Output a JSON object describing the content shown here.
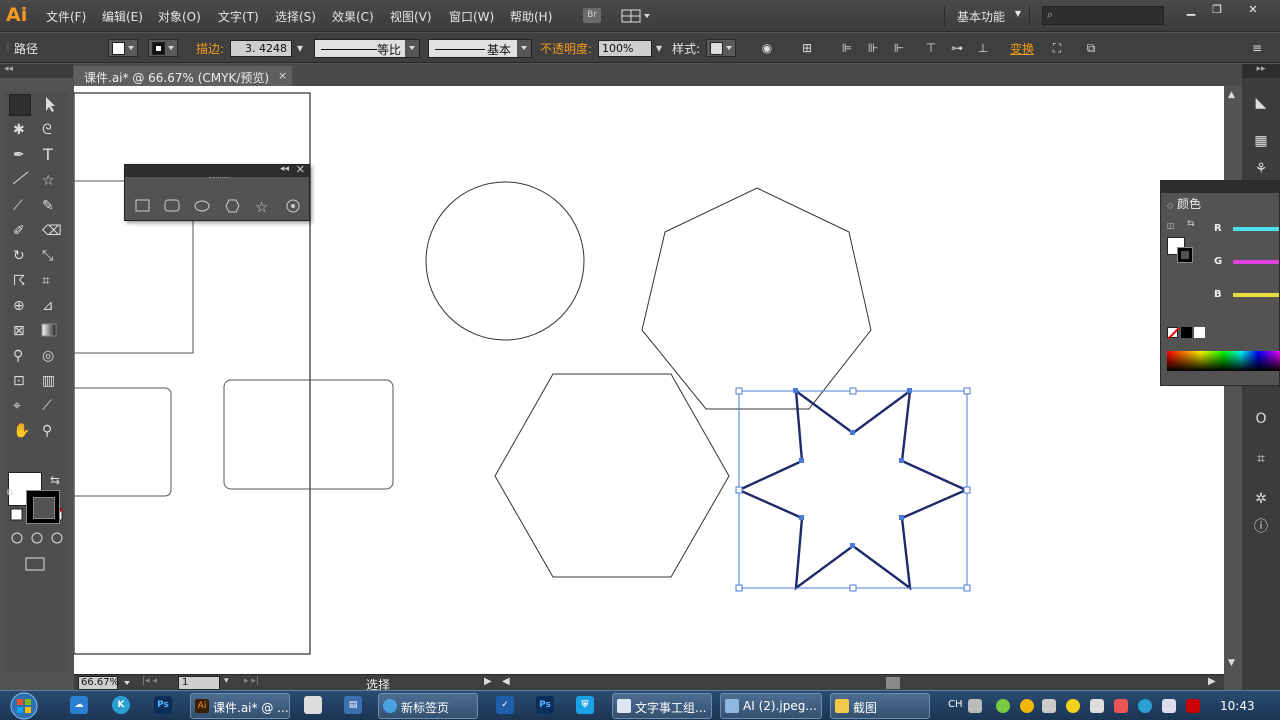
{
  "app": {
    "logo": "Ai",
    "menu": [
      "文件(F)",
      "编辑(E)",
      "对象(O)",
      "文字(T)",
      "选择(S)",
      "效果(C)",
      "视图(V)",
      "窗口(W)",
      "帮助(H)"
    ],
    "bridge_label": "Br",
    "workspace_label": "基本功能",
    "search_placeholder": ""
  },
  "controlbar": {
    "selection_type": "路径",
    "stroke_label": "描边:",
    "stroke_weight": "3. 4248",
    "stroke_profile": "等比",
    "brush": "基本",
    "opacity_label": "不透明度:",
    "opacity_value": "100%",
    "style_label": "样式:",
    "transform_label": "变换"
  },
  "document": {
    "tab_title": "课件.ai* @ 66.67% (CMYK/预览)",
    "close": "×"
  },
  "statusbar": {
    "zoom": "66.67%",
    "page": "1",
    "status": "选择"
  },
  "color_panel": {
    "title": "颜色",
    "channels": [
      {
        "label": "R",
        "color": "#4be3e9"
      },
      {
        "label": "G",
        "color": "#e040e0"
      },
      {
        "label": "B",
        "color": "#e8e040"
      }
    ]
  },
  "tools": [
    "selection-tool",
    "direct-selection-tool",
    "magic-wand-tool",
    "lasso-tool",
    "pen-tool",
    "type-tool",
    "line-tool",
    "star-tool",
    "paintbrush-tool",
    "pencil-tool",
    "blob-brush-tool",
    "eraser-tool",
    "rotate-tool",
    "scale-tool",
    "warp-tool",
    "free-transform-tool",
    "shape-builder-tool",
    "perspective-grid-tool",
    "mesh-tool",
    "gradient-tool",
    "eyedropper-tool",
    "blend-tool",
    "symbol-sprayer-tool",
    "column-graph-tool",
    "artboard-tool",
    "slice-tool",
    "hand-tool",
    "zoom-tool"
  ],
  "taskbar": {
    "buttons": [
      "课件.ai* @ ...",
      "新标签页",
      "文字事工组...",
      "AI (2).jpeg...",
      "截图"
    ],
    "ime": "CH",
    "clock": "10:43"
  }
}
